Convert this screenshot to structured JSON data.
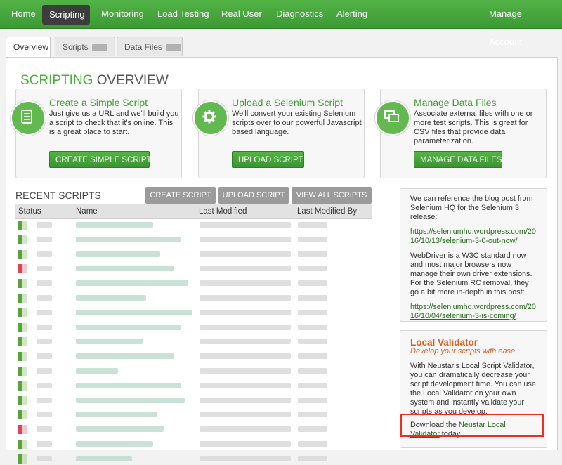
{
  "nav": {
    "items": [
      "Home",
      "Scripting",
      "Monitoring",
      "Load Testing",
      "Real User",
      "Diagnostics",
      "Alerting"
    ],
    "active": "Scripting",
    "manage_account": "Manage Account"
  },
  "tabs": [
    "Overview",
    "Scripts",
    "Data Files"
  ],
  "page_title": {
    "highlight": "SCRIPTING",
    "rest": " OVERVIEW"
  },
  "cards": [
    {
      "title": "Create a Simple Script",
      "text": "Just give us a URL and we'll build you a script to check that it's online. This is a great place to start.",
      "button": "CREATE SIMPLE SCRIPT",
      "icon": "document-icon"
    },
    {
      "title": "Upload a Selenium Script",
      "text": "We'll convert your existing Selenium scripts over to our powerful Javascript based language.",
      "button": "UPLOAD SCRIPT",
      "icon": "gear-icon"
    },
    {
      "title": "Manage Data Files",
      "text": "Associate external files with one or more test scripts. This is great for CSV files that provide data parameterization.",
      "button": "MANAGE DATA FILES",
      "icon": "windows-icon"
    }
  ],
  "recent": {
    "title": "RECENT SCRIPTS",
    "buttons": [
      "CREATE SCRIPT",
      "UPLOAD SCRIPT",
      "VIEW ALL SCRIPTS"
    ],
    "columns": [
      "Status",
      "Name",
      "Last Modified",
      "Last Modified By"
    ],
    "status_colors": [
      "green",
      "green",
      "green",
      "red",
      "green",
      "green",
      "green",
      "green",
      "green",
      "green",
      "green",
      "green",
      "green",
      "green",
      "red",
      "green",
      "green"
    ]
  },
  "sidebar": {
    "p1": "We can reference the blog post from Selenium HQ for the Selenium 3 release:",
    "link1": "https://seleniumhq.wordpress.com/2016/10/13/selenium-3-0-out-now/",
    "p2": "WebDriver is a W3C standard now and most major browsers now manage their own driver extensions. For the Selenium RC removal, they go a bit more in-depth in this post:",
    "link2": "https://seleniumhq.wordpress.com/2016/10/04/selenium-3-is-coming/"
  },
  "validator": {
    "title": "Local Validator",
    "subtitle": "Develop your scripts with ease.",
    "text": "With Neustar's Local Script Validator, you can dramatically decrease your script development time. You can use the Local Validator on your own system and instantly validate your scripts as you develop.",
    "download_prefix": "Download the ",
    "download_link": "Neustar Local Validator",
    "download_suffix": " today."
  },
  "colors": {
    "brand_green": "#4caf3f",
    "accent_orange": "#e05a1c",
    "highlight_red": "#e8321e"
  }
}
